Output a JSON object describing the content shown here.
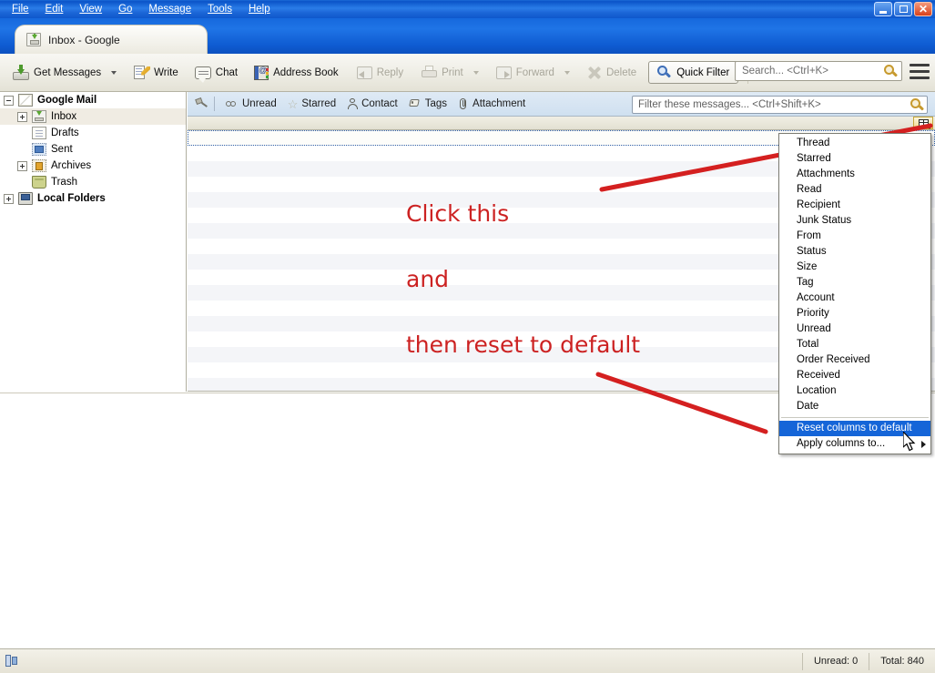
{
  "window": {
    "title": "Inbox - Google",
    "controls": {
      "minimize": "_",
      "maximize": "❐",
      "close": "✕"
    }
  },
  "menubar": [
    {
      "label": "File"
    },
    {
      "label": "Edit"
    },
    {
      "label": "View"
    },
    {
      "label": "Go"
    },
    {
      "label": "Message"
    },
    {
      "label": "Tools"
    },
    {
      "label": "Help"
    }
  ],
  "tab": {
    "label": "Inbox - Google",
    "icon": "inbox-icon"
  },
  "toolbar": {
    "get_messages": "Get Messages",
    "write": "Write",
    "chat": "Chat",
    "address_book": "Address Book",
    "reply": "Reply",
    "print": "Print",
    "forward": "Forward",
    "delete": "Delete",
    "quick_filter": "Quick Filter",
    "search_placeholder": "Search... <Ctrl+K>",
    "search_value": ""
  },
  "quickfilter": {
    "items": [
      {
        "label": "Unread",
        "icon": "unread-icon"
      },
      {
        "label": "Starred",
        "icon": "star-icon"
      },
      {
        "label": "Contact",
        "icon": "contact-icon"
      },
      {
        "label": "Tags",
        "icon": "tag-icon"
      },
      {
        "label": "Attachment",
        "icon": "attachment-icon"
      }
    ],
    "filter_placeholder": "Filter these messages... <Ctrl+Shift+K>",
    "filter_value": ""
  },
  "folderpane": {
    "rows": [
      {
        "label": "Google Mail",
        "icon": "account-icon",
        "twisty": "minus",
        "indent": 0,
        "bold": true,
        "selected": false
      },
      {
        "label": "Inbox",
        "icon": "inbox-icon",
        "twisty": "plus",
        "indent": 1,
        "bold": false,
        "selected": true
      },
      {
        "label": "Drafts",
        "icon": "drafts-icon",
        "twisty": "none",
        "indent": 1,
        "bold": false,
        "selected": false
      },
      {
        "label": "Sent",
        "icon": "sent-icon",
        "twisty": "none",
        "indent": 1,
        "bold": false,
        "selected": false
      },
      {
        "label": "Archives",
        "icon": "archives-icon",
        "twisty": "plus",
        "indent": 1,
        "bold": false,
        "selected": false
      },
      {
        "label": "Trash",
        "icon": "trash-icon",
        "twisty": "none",
        "indent": 1,
        "bold": false,
        "selected": false
      },
      {
        "label": "Local Folders",
        "icon": "local-folders-icon",
        "twisty": "plus",
        "indent": 0,
        "bold": true,
        "selected": false
      }
    ]
  },
  "column_menu": {
    "items": [
      {
        "label": "Thread"
      },
      {
        "label": "Starred"
      },
      {
        "label": "Attachments"
      },
      {
        "label": "Read"
      },
      {
        "label": "Recipient"
      },
      {
        "label": "Junk Status"
      },
      {
        "label": "From"
      },
      {
        "label": "Status"
      },
      {
        "label": "Size"
      },
      {
        "label": "Tag"
      },
      {
        "label": "Account"
      },
      {
        "label": "Priority"
      },
      {
        "label": "Unread"
      },
      {
        "label": "Total"
      },
      {
        "label": "Order Received"
      },
      {
        "label": "Received"
      },
      {
        "label": "Location"
      },
      {
        "label": "Date"
      }
    ],
    "actions": [
      {
        "label": "Reset columns to default",
        "highlighted": true,
        "submenu": false
      },
      {
        "label": "Apply columns to...",
        "highlighted": false,
        "submenu": true
      }
    ]
  },
  "annotations": [
    {
      "text": "Click this"
    },
    {
      "text": "and"
    },
    {
      "text": "then reset to default"
    }
  ],
  "statusbar": {
    "unread": "Unread: 0",
    "total": "Total: 840"
  },
  "colors": {
    "titlebar_blue": "#1b66d6",
    "annotation_red": "#cc2222",
    "menu_highlight": "#1565d8",
    "selected_folder": "#f0ece3"
  }
}
